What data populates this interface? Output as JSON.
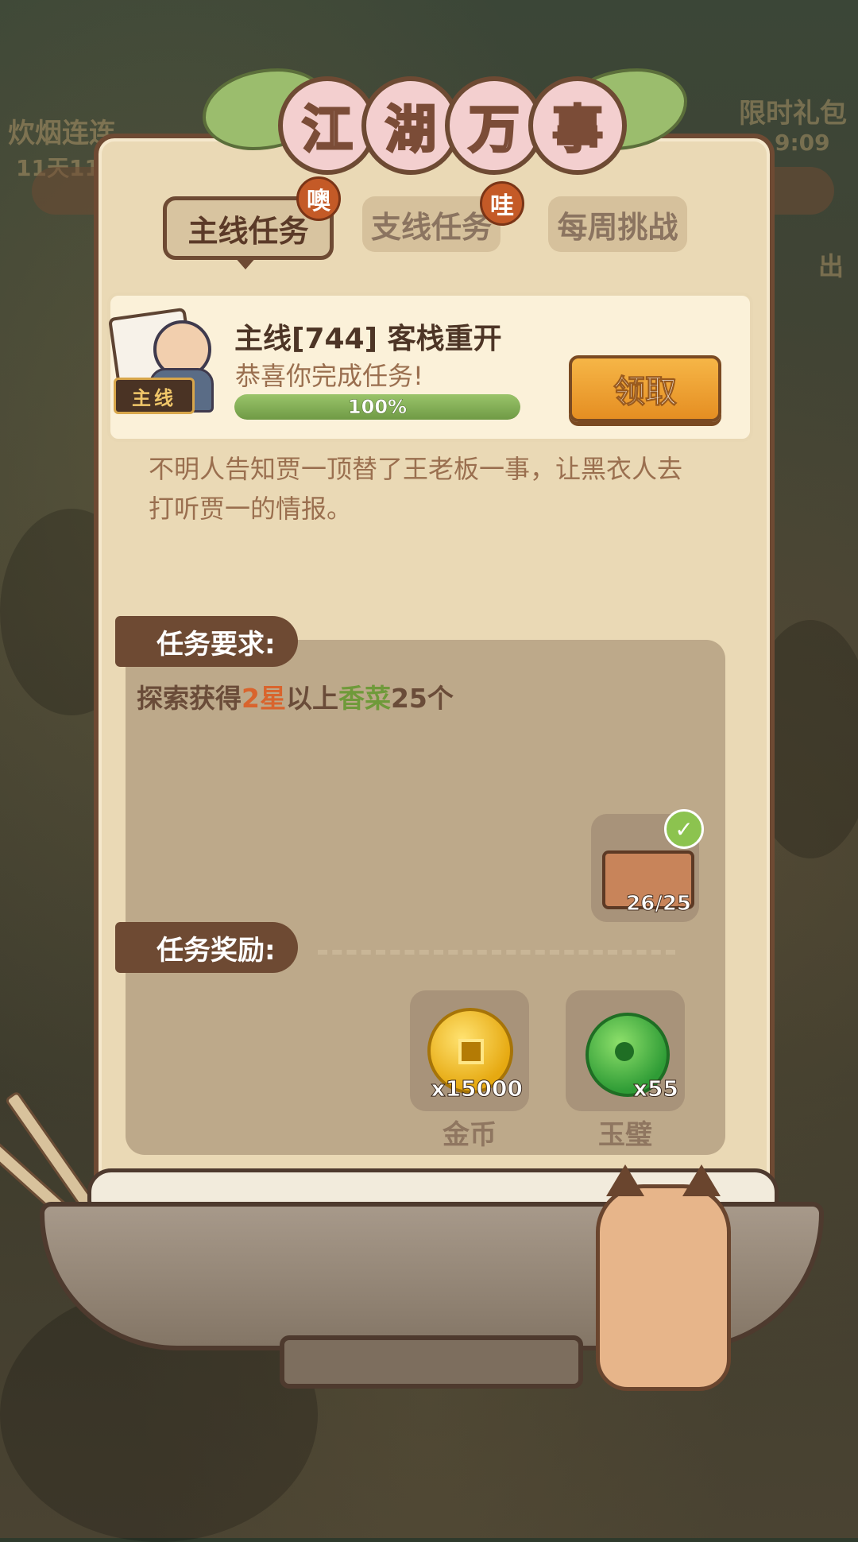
{
  "background": {
    "left_event_label": "炊烟连连",
    "left_timer": "11天11",
    "right_gift_label": "限时礼包",
    "right_timer": "9:09",
    "right_side_text": "出"
  },
  "panel": {
    "title_chars": [
      "江",
      "湖",
      "万",
      "事"
    ]
  },
  "tabs": [
    {
      "label": "主线任务",
      "badge": "噢",
      "active": true
    },
    {
      "label": "支线任务",
      "badge": "哇",
      "active": false
    },
    {
      "label": "每周挑战",
      "badge": "",
      "active": false
    }
  ],
  "task": {
    "tag": "主线",
    "title": "主线[744] 客栈重开",
    "subtitle": "恭喜你完成任务!",
    "progress_percent": 100,
    "progress_text": "100%",
    "claim_label": "领取",
    "description": "不明人告知贾一顶替了王老板一事，让黑衣人去打听贾一的情报。"
  },
  "requirement": {
    "section_label": "任务要求:",
    "text_parts": [
      "探索获得",
      "2星",
      "以上",
      "香菜",
      "25个"
    ],
    "item": {
      "icon": "food-crate-icon",
      "count": "26/25",
      "completed": true
    }
  },
  "rewards": {
    "section_label": "任务奖励:",
    "items": [
      {
        "icon": "gold-coin-icon",
        "count": "x15000",
        "name": "金币"
      },
      {
        "icon": "jade-bi-icon",
        "count": "x55",
        "name": "玉璧"
      }
    ]
  },
  "colors": {
    "panel_bg": "#ead9b5",
    "frame": "#6e4a33",
    "accent_orange": "#e58e22",
    "progress_green": "#6f9a45",
    "highlight_red": "#d9642d",
    "highlight_green": "#6f9a3a"
  }
}
